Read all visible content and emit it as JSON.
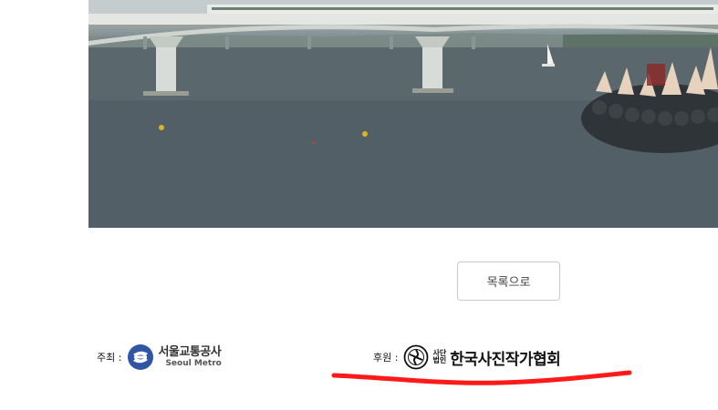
{
  "list_button": {
    "label": "목록으로"
  },
  "host": {
    "label": "주최 :",
    "logo_korean": "서울교통공사",
    "logo_english": "Seoul Metro"
  },
  "support": {
    "label": "후원 :",
    "logo_small_top": "사단",
    "logo_small_bottom": "법인",
    "logo_name": "한국사진작가협회"
  },
  "colors": {
    "metro_blue": "#2f55a4",
    "annotation_red": "#ff1a1a",
    "button_border": "#c9c9c9"
  }
}
